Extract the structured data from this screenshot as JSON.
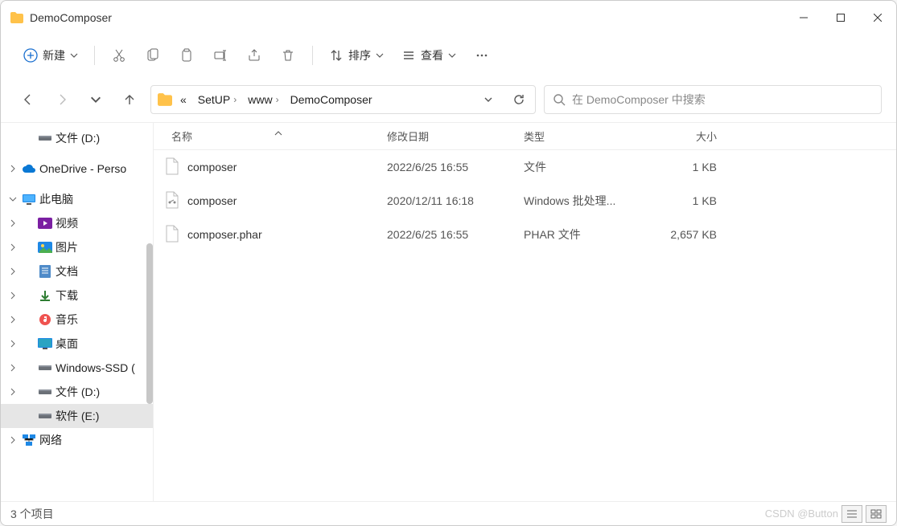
{
  "window": {
    "title": "DemoComposer"
  },
  "toolbar": {
    "new_label": "新建",
    "sort_label": "排序",
    "view_label": "查看"
  },
  "breadcrumb": {
    "ellipsis": "«",
    "items": [
      "SetUP",
      "www",
      "DemoComposer"
    ]
  },
  "search": {
    "placeholder": "在 DemoComposer 中搜索"
  },
  "tree": {
    "items": [
      {
        "label": "文件 (D:)",
        "icon": "drive",
        "depth": 1,
        "twist": "none",
        "sel": false
      },
      {
        "label": "OneDrive - Perso",
        "icon": "cloud",
        "depth": 0,
        "twist": "collapsed",
        "sel": false
      },
      {
        "label": "此电脑",
        "icon": "pc",
        "depth": 0,
        "twist": "expanded",
        "sel": false
      },
      {
        "label": "视频",
        "icon": "video",
        "depth": 1,
        "twist": "collapsed",
        "sel": false
      },
      {
        "label": "图片",
        "icon": "picture",
        "depth": 1,
        "twist": "collapsed",
        "sel": false
      },
      {
        "label": "文档",
        "icon": "docs",
        "depth": 1,
        "twist": "collapsed",
        "sel": false
      },
      {
        "label": "下载",
        "icon": "download",
        "depth": 1,
        "twist": "collapsed",
        "sel": false
      },
      {
        "label": "音乐",
        "icon": "music",
        "depth": 1,
        "twist": "collapsed",
        "sel": false
      },
      {
        "label": "桌面",
        "icon": "desktop",
        "depth": 1,
        "twist": "collapsed",
        "sel": false
      },
      {
        "label": "Windows-SSD (",
        "icon": "drive",
        "depth": 1,
        "twist": "collapsed",
        "sel": false
      },
      {
        "label": "文件 (D:)",
        "icon": "drive",
        "depth": 1,
        "twist": "collapsed",
        "sel": false
      },
      {
        "label": "软件 (E:)",
        "icon": "drive",
        "depth": 1,
        "twist": "none",
        "sel": true
      },
      {
        "label": "网络",
        "icon": "network",
        "depth": 0,
        "twist": "collapsed",
        "sel": false
      }
    ]
  },
  "columns": {
    "name": "名称",
    "date": "修改日期",
    "type": "类型",
    "size": "大小"
  },
  "files": [
    {
      "name": "composer",
      "date": "2022/6/25 16:55",
      "type": "文件",
      "size": "1 KB",
      "icon": "file"
    },
    {
      "name": "composer",
      "date": "2020/12/11 16:18",
      "type": "Windows 批处理...",
      "size": "1 KB",
      "icon": "bat"
    },
    {
      "name": "composer.phar",
      "date": "2022/6/25 16:55",
      "type": "PHAR 文件",
      "size": "2,657 KB",
      "icon": "file"
    }
  ],
  "status": {
    "count_label": "3 个项目"
  },
  "watermark": "CSDN @Button"
}
